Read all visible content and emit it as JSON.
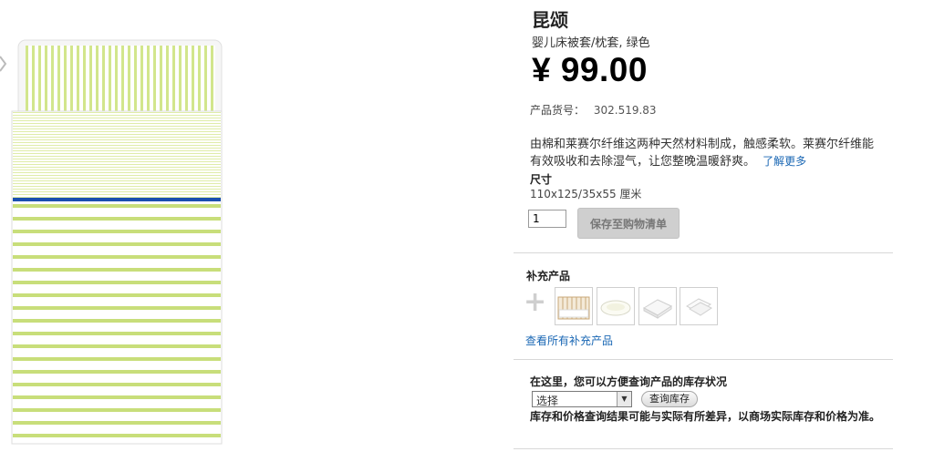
{
  "product": {
    "name": "昆颂",
    "short_description": "婴儿床被套/枕套, 绿色",
    "price": "¥ 99.00",
    "article_label": "产品货号：",
    "article_number": "302.519.83",
    "long_description": "由棉和莱赛尔纤维这两种天然材料制成，触感柔软。莱赛尔纤维能有效吸收和去除湿气，让您整晚温暖舒爽。",
    "learn_more": "了解更多",
    "size_label": "尺寸",
    "size_value": "110x125/35x55 厘米"
  },
  "cart": {
    "quantity": "1",
    "add_button": "保存至购物清单"
  },
  "complementary": {
    "title": "补充产品",
    "see_all": "查看所有补充产品",
    "thumbnails": [
      "crib-thumbnail",
      "pillow-thumbnail",
      "mattress-thumbnail",
      "pillowcase-thumbnail"
    ]
  },
  "stock": {
    "title": "在这里，您可以方便查询产品的库存状况",
    "select_value": "选择",
    "check_button": "查询库存",
    "note": "库存和价格查询结果可能与实际有所差异，以商场实际库存和价格为准。"
  },
  "colors": {
    "stripe_green": "#c8de7a",
    "band_blue": "#1a4fb0",
    "link_blue": "#1a67b4"
  }
}
